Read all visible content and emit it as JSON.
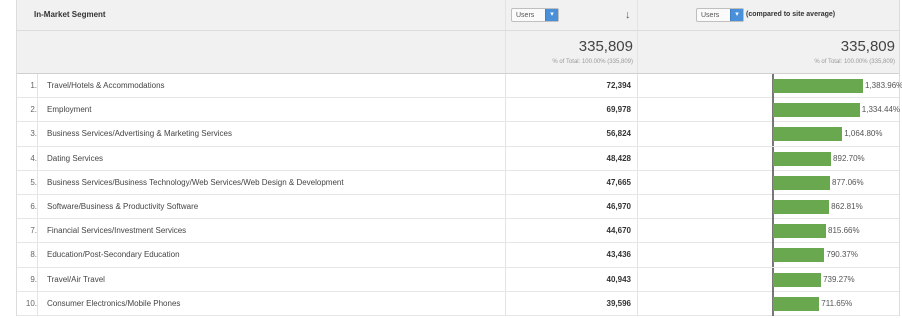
{
  "header": {
    "dimension_label": "In-Market Segment",
    "metric_select": "Users",
    "compare_select": "Users",
    "compare_note": "(compared to site average)"
  },
  "totals": {
    "users_value": "335,809",
    "users_sub": "% of Total: 100.00% (335,809)",
    "compare_value": "335,809",
    "compare_sub": "% of Total: 100.00% (335,809)"
  },
  "rows": [
    {
      "index": "1.",
      "segment": "Travel/Hotels & Accommodations",
      "users": "72,394",
      "pct_label": "1,383.96%",
      "pct": 1383.96
    },
    {
      "index": "2.",
      "segment": "Employment",
      "users": "69,978",
      "pct_label": "1,334.44%",
      "pct": 1334.44
    },
    {
      "index": "3.",
      "segment": "Business Services/Advertising & Marketing Services",
      "users": "56,824",
      "pct_label": "1,064.80%",
      "pct": 1064.8
    },
    {
      "index": "4.",
      "segment": "Dating Services",
      "users": "48,428",
      "pct_label": "892.70%",
      "pct": 892.7
    },
    {
      "index": "5.",
      "segment": "Business Services/Business Technology/Web Services/Web Design & Development",
      "users": "47,665",
      "pct_label": "877.06%",
      "pct": 877.06
    },
    {
      "index": "6.",
      "segment": "Software/Business & Productivity Software",
      "users": "46,970",
      "pct_label": "862.81%",
      "pct": 862.81
    },
    {
      "index": "7.",
      "segment": "Financial Services/Investment Services",
      "users": "44,670",
      "pct_label": "815.66%",
      "pct": 815.66
    },
    {
      "index": "8.",
      "segment": "Education/Post-Secondary Education",
      "users": "43,436",
      "pct_label": "790.37%",
      "pct": 790.37
    },
    {
      "index": "9.",
      "segment": "Travel/Air Travel",
      "users": "40,943",
      "pct_label": "739.27%",
      "pct": 739.27
    },
    {
      "index": "10.",
      "segment": "Consumer Electronics/Mobile Phones",
      "users": "39,596",
      "pct_label": "711.65%",
      "pct": 711.65
    }
  ],
  "colors": {
    "bar": "#6aa84f",
    "select_accent": "#4a90d9"
  },
  "icons": {
    "sort": "sort-down-arrow-icon",
    "select": "select-dropdown-icon"
  }
}
